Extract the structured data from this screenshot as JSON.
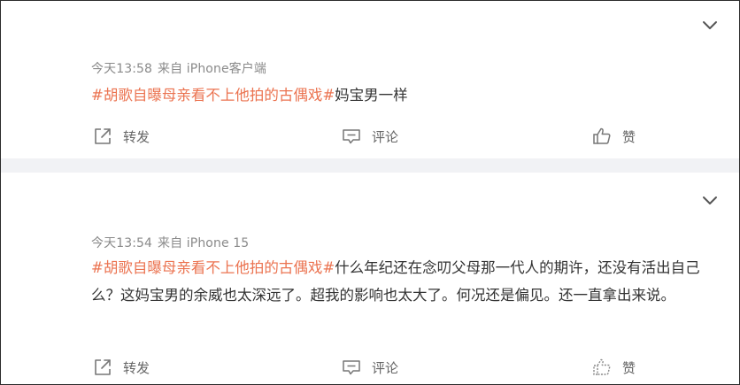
{
  "posts": [
    {
      "time": "今天13:58",
      "source": "来自 iPhone客户端",
      "topic": "#胡歌自曝母亲看不上他拍的古偶戏#",
      "text": "妈宝男一样",
      "actions": {
        "forward": "转发",
        "comment": "评论",
        "like": "赞"
      }
    },
    {
      "time": "今天13:54",
      "source": "来自 iPhone 15",
      "topic": "#胡歌自曝母亲看不上他拍的古偶戏#",
      "text": "什么年纪还在念叨父母那一代人的期许，还没有活出自己么？这妈宝男的余威也太深远了。超我的影响也太大了。何况还是偏见。还一直拿出来说。",
      "actions": {
        "forward": "转发",
        "comment": "评论",
        "like": "赞"
      }
    }
  ],
  "icons": {
    "menu": "chevron-down-icon",
    "forward": "share-forward-icon",
    "comment": "comment-icon",
    "like": "thumbs-up-icon"
  },
  "colors": {
    "topic": "#eb7350",
    "meta": "#8a8a8a",
    "text": "#333333",
    "action": "#666666",
    "divider": "#f1f2f5"
  }
}
